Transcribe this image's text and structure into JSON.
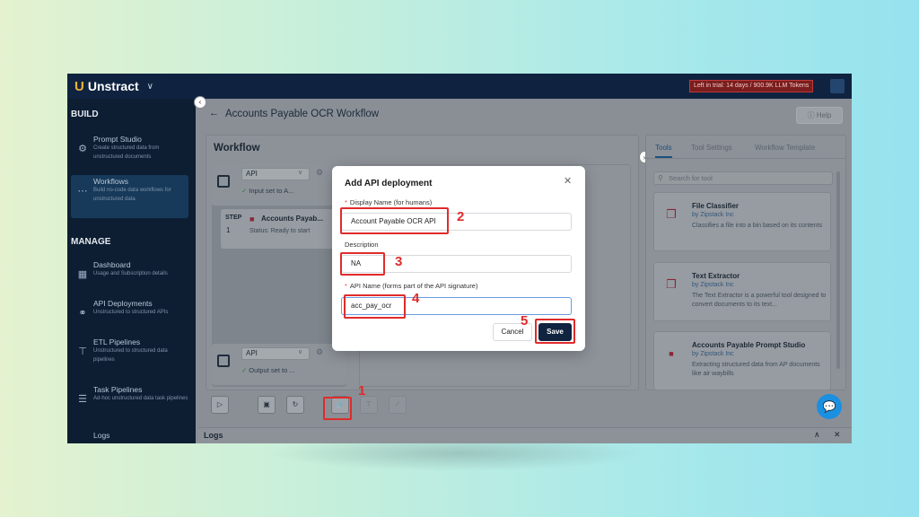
{
  "topbar": {
    "logo": "Unstract",
    "trial_notice": "Left in trial: 14 days / 900.9K LLM Tokens"
  },
  "sidebar": {
    "build_title": "BUILD",
    "manage_title": "MANAGE",
    "items": [
      {
        "title": "Prompt Studio",
        "desc": "Create structured data from unstructured documents"
      },
      {
        "title": "Workflows",
        "desc": "Build no-code data workflows for unstructured data"
      },
      {
        "title": "Dashboard",
        "desc": "Usage and Subscription details"
      },
      {
        "title": "API Deployments",
        "desc": "Unstructured to structured APIs"
      },
      {
        "title": "ETL Pipelines",
        "desc": "Unstructured to structured data pipelines"
      },
      {
        "title": "Task Pipelines",
        "desc": "Ad-hoc unstructured data task pipelines"
      },
      {
        "title": "Logs",
        "desc": ""
      }
    ]
  },
  "header": {
    "title": "Accounts Payable OCR Workflow",
    "help_label": "Help"
  },
  "workflow": {
    "title": "Workflow",
    "input": {
      "select": "API",
      "status": "Input set to A..."
    },
    "step": {
      "label": "STEP",
      "number": "1",
      "name": "Accounts Payab...",
      "status": "Status: Ready to start"
    },
    "output": {
      "select": "API",
      "status": "Output set to ..."
    }
  },
  "tools": {
    "tabs": [
      "Tools",
      "Tool Settings",
      "Workflow Template"
    ],
    "search_placeholder": "Search for tool",
    "items": [
      {
        "name": "File Classifier",
        "by": "by Zipstack Inc",
        "desc": "Classifies a file into a bin based on its contents"
      },
      {
        "name": "Text Extractor",
        "by": "by Zipstack Inc",
        "desc": "The Text Extractor is a powerful tool designed to convert documents to its text..."
      },
      {
        "name": "Accounts Payable Prompt Studio",
        "by": "by Zipstack Inc",
        "desc": "Extracting structured data from AP documents like air waybills"
      }
    ]
  },
  "logs": {
    "title": "Logs"
  },
  "modal": {
    "title": "Add API deployment",
    "display_name_label": "Display Name (for humans)",
    "display_name_value": "Account Payable OCR API",
    "description_label": "Description",
    "description_value": "NA",
    "api_name_label": "API Name (forms part of the API signature)",
    "api_name_value": "acc_pay_ocr",
    "cancel_label": "Cancel",
    "save_label": "Save"
  },
  "annotations": [
    "1",
    "2",
    "3",
    "4",
    "5"
  ],
  "colors": {
    "highlight": "#e02b2b",
    "sidebar": "#0d1e33",
    "save_button": "#10233f",
    "chat_button": "#1b8fe0"
  }
}
